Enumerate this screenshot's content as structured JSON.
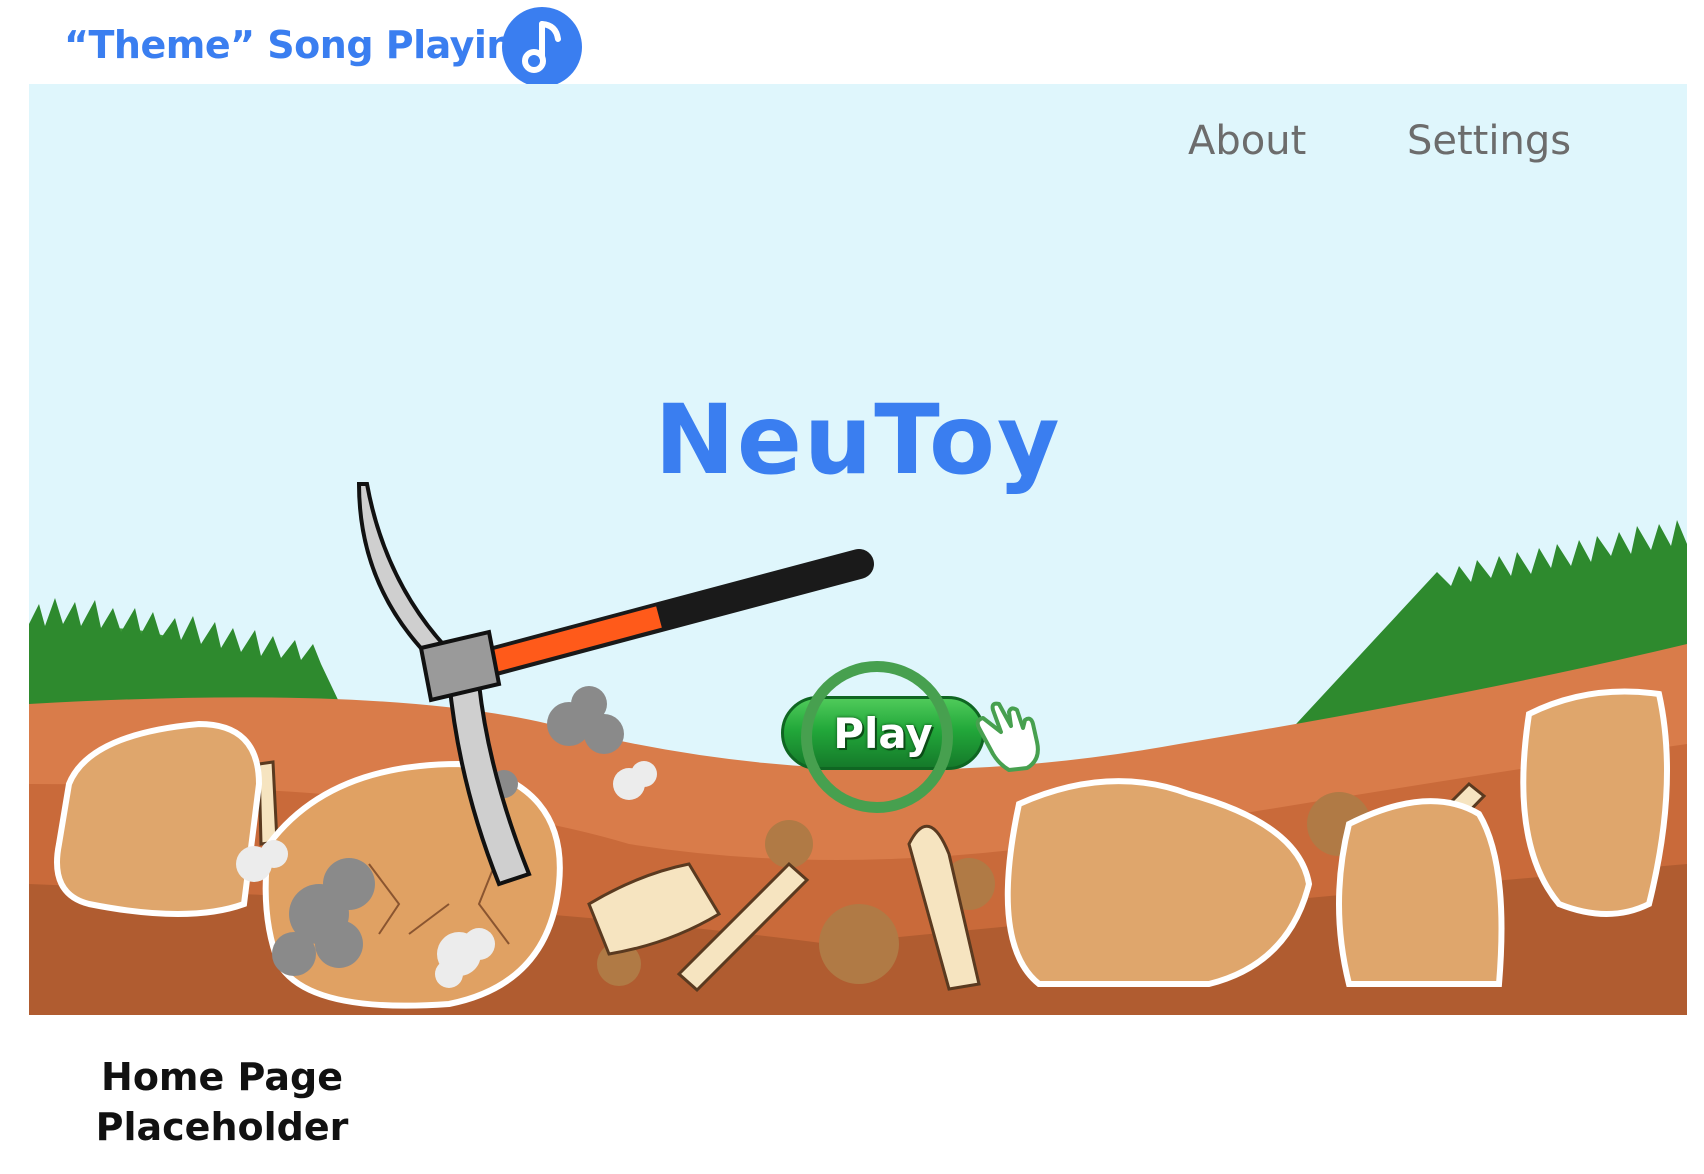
{
  "status": {
    "song_label": "“Theme” Song Playing",
    "music_icon": "music-note-icon",
    "accent_color": "#3a7ef0"
  },
  "nav": {
    "about": "About",
    "settings": "Settings"
  },
  "hero": {
    "title": "NeuToy",
    "play_label": "Play"
  },
  "caption": {
    "line1": "Home Page",
    "line2": "Placeholder"
  }
}
